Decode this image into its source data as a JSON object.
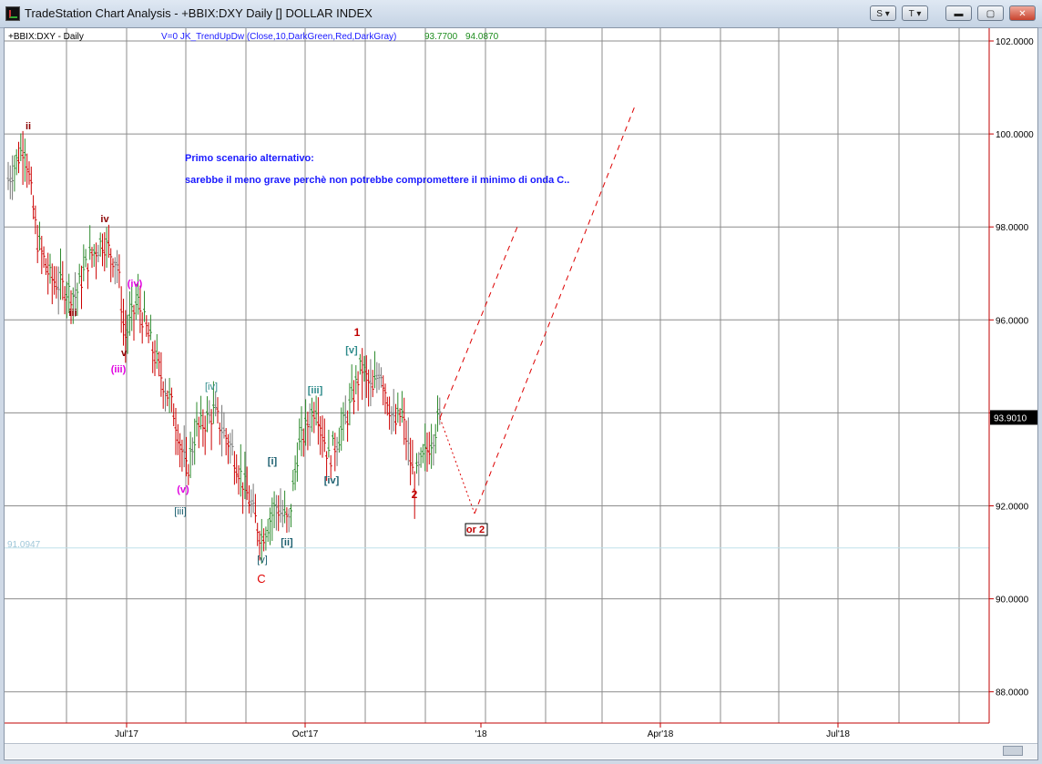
{
  "window": {
    "title": "TradeStation Chart Analysis - +BBIX:DXY Daily [] DOLLAR INDEX",
    "buttons": [
      "S",
      "T"
    ]
  },
  "chart_header": {
    "symbol": "+BBIX:DXY - Daily",
    "indicator": "V=0  JK_TrendUpDw  (Close,10,DarkGreen,Red,DarkGray)",
    "value1": "93.7700",
    "value2": "94.0870"
  },
  "annotation": {
    "line1": "Primo scenario alternativo:",
    "line2": "sarebbe il meno grave perchè non potrebbe compromettere il minimo di onda C.."
  },
  "price_marker": "93.9010",
  "low_label": "91.0947",
  "chart_data": {
    "type": "bar",
    "y_range": [
      87.0,
      102.5
    ],
    "y_ticks": [
      "102.0000",
      "100.0000",
      "98.0000",
      "96.0000",
      "94.0000",
      "92.0000",
      "90.0000",
      "88.0000"
    ],
    "y_tick_values": [
      102,
      100,
      98,
      96,
      94,
      92,
      90,
      88
    ],
    "x_ticks": [
      "Jul'17",
      "Oct'17",
      "'18",
      "Apr'18",
      "Jul'18"
    ],
    "grid": true,
    "current_price": 93.901,
    "low_line": 91.0947,
    "wave_labels": [
      {
        "text": "ii",
        "color": "#8b0000"
      },
      {
        "text": "iv",
        "color": "#8b0000"
      },
      {
        "text": "iii",
        "color": "#8b0000"
      },
      {
        "text": "v",
        "color": "#8b0000"
      },
      {
        "text": "(iv)",
        "color": "#e000e0"
      },
      {
        "text": "(iii)",
        "color": "#e000e0"
      },
      {
        "text": "(v)",
        "color": "#e000e0"
      },
      {
        "text": "[iv]",
        "color": "#2e8b8b"
      },
      {
        "text": "[iii]",
        "color": "#2e8b8b"
      },
      {
        "text": "[v]",
        "color": "#2e8b8b"
      },
      {
        "text": "[i]",
        "color": "#1a5e6e"
      },
      {
        "text": "[ii]",
        "color": "#1a5e6e"
      },
      {
        "text": "[iii]",
        "color": "#1a5e6e"
      },
      {
        "text": "[iv]",
        "color": "#1a5e6e"
      },
      {
        "text": "[v]",
        "color": "#1a5e6e"
      },
      {
        "text": "C",
        "color": "#e00000"
      },
      {
        "text": "1",
        "color": "#c00000"
      },
      {
        "text": "2",
        "color": "#c00000"
      },
      {
        "text": "or 2",
        "color": "#c00000"
      }
    ],
    "colors": {
      "up": "#2e8b2e",
      "down": "#cc0000",
      "neutral": "#777777",
      "grid": "#8c8c8c",
      "axis": "#c00000",
      "projection": "#dd0000"
    }
  }
}
